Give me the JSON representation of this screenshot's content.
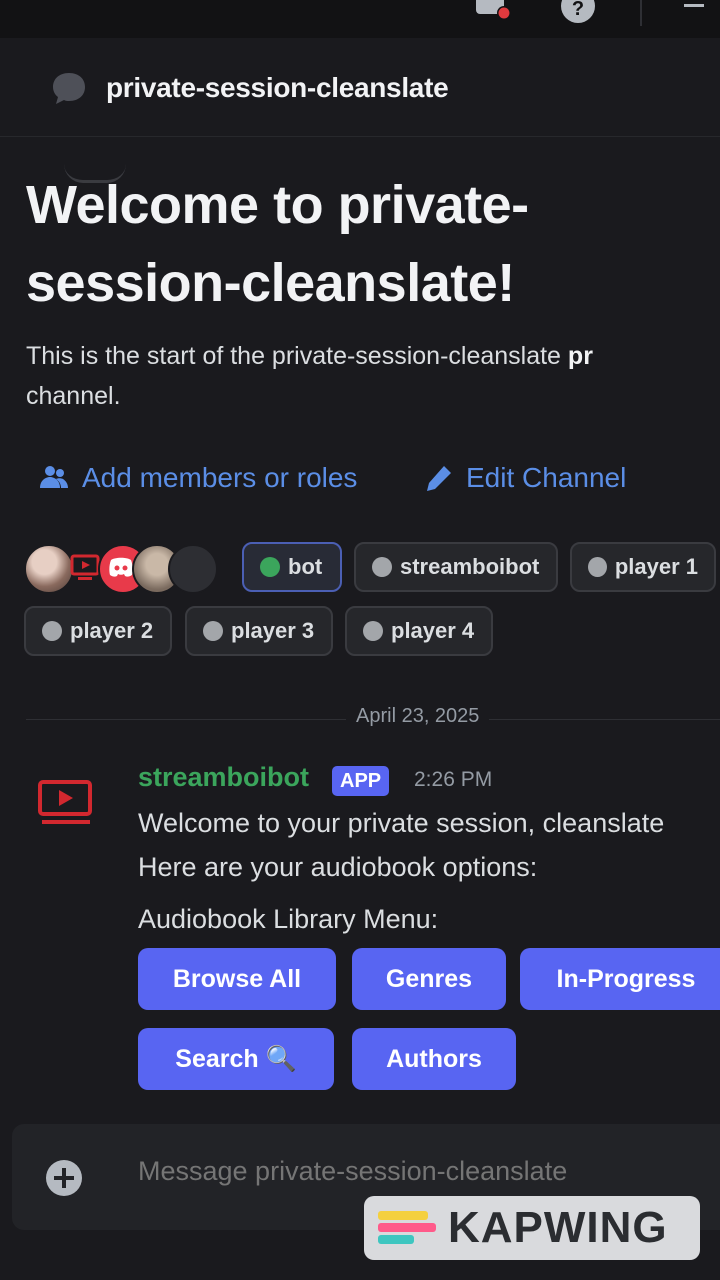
{
  "channel": {
    "name": "private-session-cleanslate"
  },
  "welcome": {
    "heading_line1": "Welcome to private-",
    "heading_line2": "session-cleanslate!",
    "desc_line1_start": "This is the start of the private-session-cleanslate ",
    "desc_line1_bold": "pr",
    "desc_line2": "channel."
  },
  "actions": {
    "add_members": "Add members or roles",
    "edit_channel": "Edit Channel"
  },
  "members": [
    {
      "label": "bot",
      "selected": true
    },
    {
      "label": "streamboibot",
      "selected": false
    },
    {
      "label": "player 1",
      "selected": false
    },
    {
      "label": "player 2",
      "selected": false
    },
    {
      "label": "player 3",
      "selected": false
    },
    {
      "label": "player 4",
      "selected": false
    }
  ],
  "date_divider": "April 23, 2025",
  "message": {
    "author": "streamboibot",
    "badge": "APP",
    "time": "2:26 PM",
    "line1": "Welcome to your private session, cleanslate",
    "line2": "Here are your audiobook options:",
    "line3": "Audiobook Library Menu:",
    "buttons": [
      "Browse All",
      "Genres",
      "In-Progress",
      "Search 🔍",
      "Authors"
    ]
  },
  "composer": {
    "placeholder": "Message private-session-cleanslate"
  },
  "watermark": {
    "text": "KAPWING"
  },
  "colors": {
    "accent": "#5865f2",
    "link": "#5b8ee6",
    "bot_green": "#3ba55c",
    "background": "#1a1a1e"
  }
}
